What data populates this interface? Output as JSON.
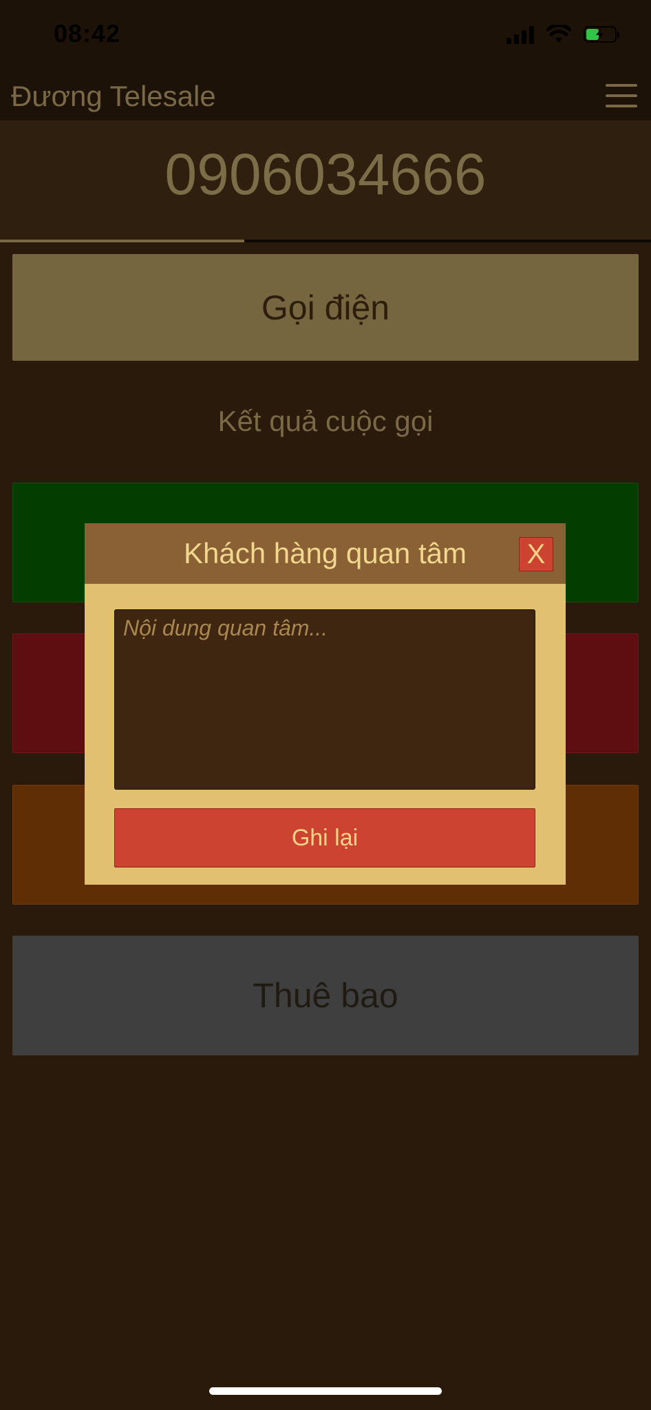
{
  "status_bar": {
    "time": "08:42",
    "icons": [
      "cellular-signal-icon",
      "wifi-icon",
      "battery-charging-icon"
    ]
  },
  "header": {
    "title": "Đương Telesale",
    "menu_icon": "hamburger-menu-icon"
  },
  "phone": {
    "number": "0906034666",
    "progress_fraction": 0.375
  },
  "actions": {
    "call_label": "Gọi điện",
    "result_section_label": "Kết quả cuộc gọi",
    "subscriber_label": "Thuê bao"
  },
  "modal": {
    "title": "Khách hàng quan tâm",
    "close_label": "X",
    "textarea_placeholder": "Nội dung quan tâm...",
    "save_label": "Ghi lại"
  },
  "colors": {
    "background": "#2a1a0c",
    "interested_button": "#043d00",
    "rejected_button": "#5e0d10",
    "callback_button": "#5f2e04",
    "subscriber_button": "#3f3f3f",
    "modal_accent": "#cd4332",
    "modal_body": "#e1c072",
    "modal_header": "#8a6135"
  }
}
